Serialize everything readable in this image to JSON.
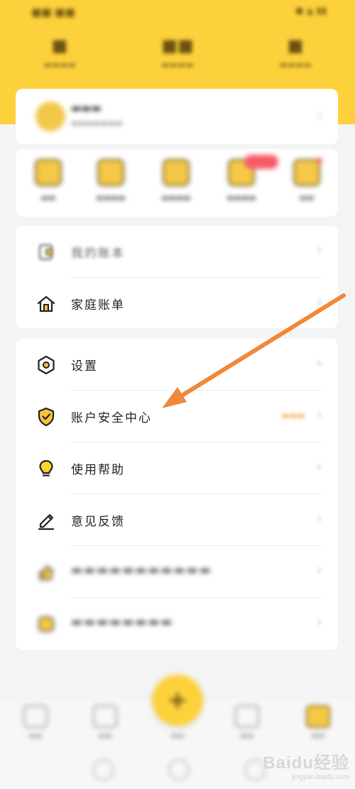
{
  "colors": {
    "brand_yellow": "#fdd13c",
    "arrow_orange": "#f0883a",
    "shield_yellow": "#f9c23c",
    "bulb_yellow": "#f9d32e"
  },
  "menu_group_2": {
    "family_bill": {
      "label": "家庭账单",
      "icon": "house-icon"
    }
  },
  "menu_group_3": {
    "settings": {
      "label": "设置",
      "icon": "settings-hex-icon"
    },
    "account_security": {
      "label": "账户安全中心",
      "icon": "shield-check-icon"
    },
    "help": {
      "label": "使用帮助",
      "icon": "lightbulb-icon"
    },
    "feedback": {
      "label": "意见反馈",
      "icon": "pencil-icon"
    }
  },
  "menu_group_1": {
    "my_ledger": {
      "label": "我的账本",
      "icon": "ledger-book-icon"
    }
  },
  "watermark": {
    "text": "Baidu经验",
    "sub": "jingyan.baidu.com"
  }
}
